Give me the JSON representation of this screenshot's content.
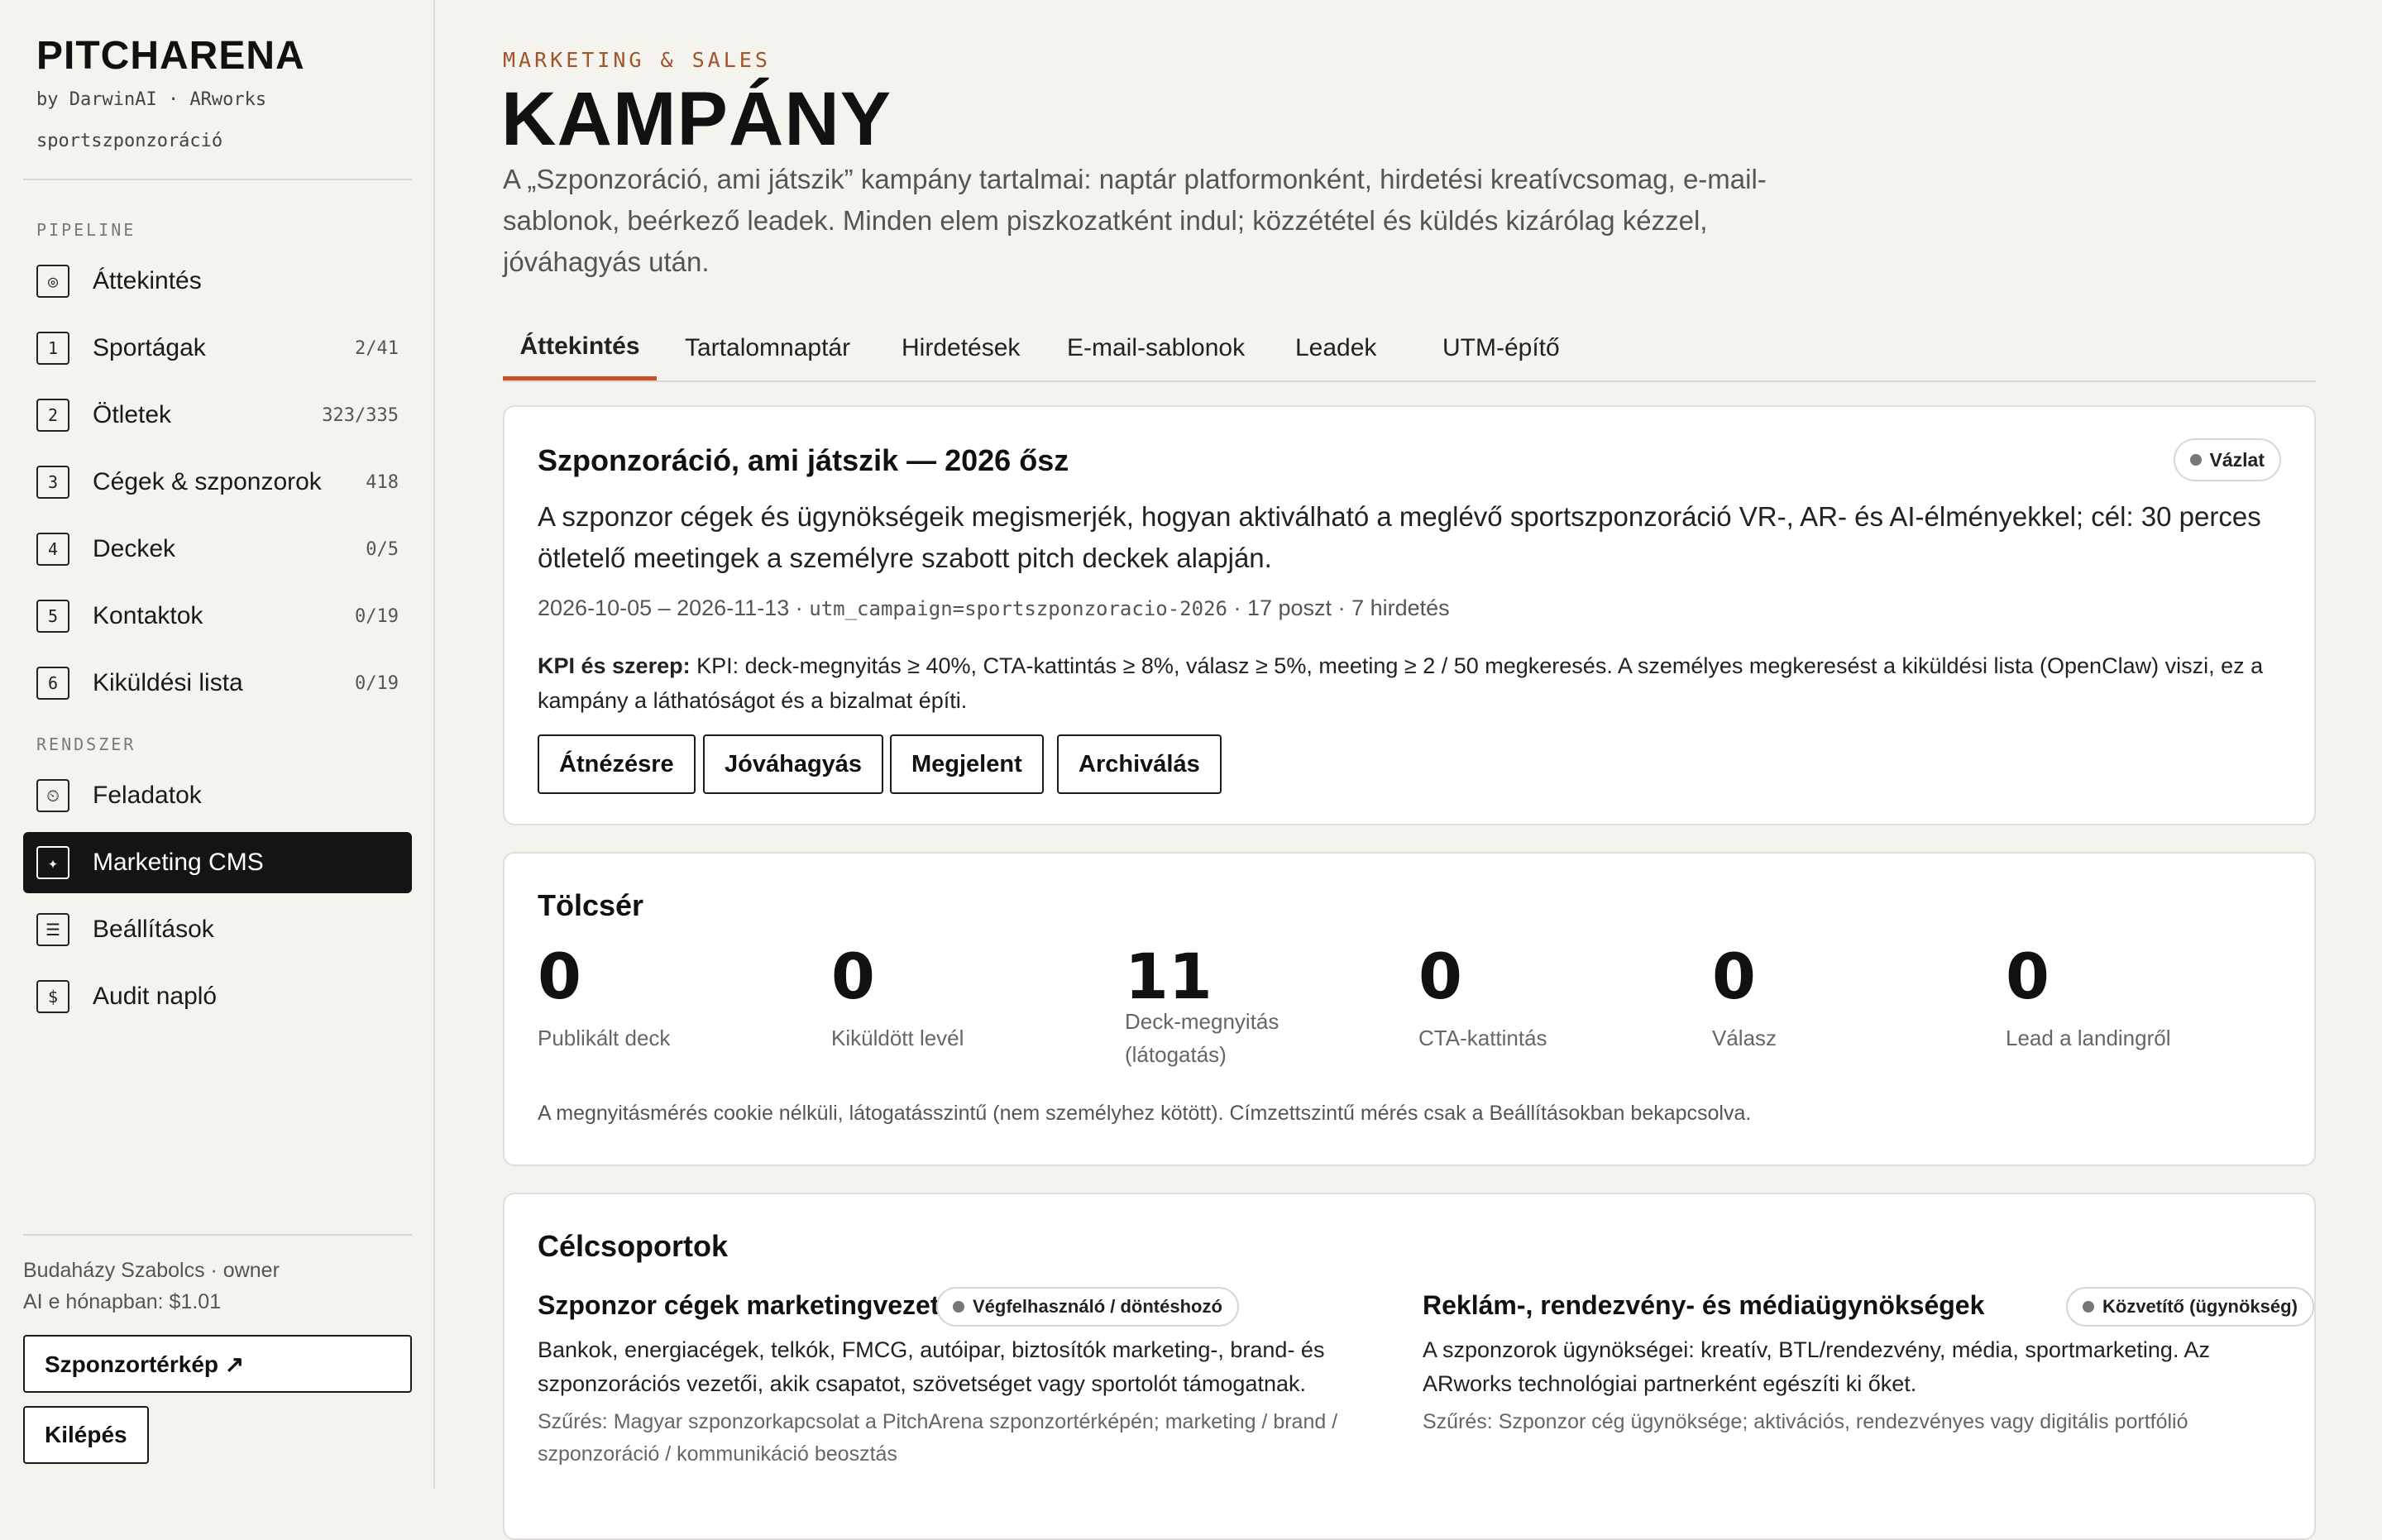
{
  "sidebar": {
    "brand": "PITCHARENA",
    "byline": "by DarwinAI · ARworks",
    "workspace": "sportszponzoráció",
    "pipeline_title": "PIPELINE",
    "system_title": "RENDSZER",
    "pipeline": [
      {
        "icon": "◎",
        "label": "Áttekintés",
        "count": ""
      },
      {
        "icon": "1",
        "label": "Sportágak",
        "count": "2/41"
      },
      {
        "icon": "2",
        "label": "Ötletek",
        "count": "323/335"
      },
      {
        "icon": "3",
        "label": "Cégek & szponzorok",
        "count": "418"
      },
      {
        "icon": "4",
        "label": "Deckek",
        "count": "0/5"
      },
      {
        "icon": "5",
        "label": "Kontaktok",
        "count": "0/19"
      },
      {
        "icon": "6",
        "label": "Kiküldési lista",
        "count": "0/19"
      }
    ],
    "system": [
      {
        "icon": "⏲",
        "label": "Feladatok"
      },
      {
        "icon": "✦",
        "label": "Marketing CMS"
      },
      {
        "icon": "☰",
        "label": "Beállítások"
      },
      {
        "icon": "$",
        "label": "Audit napló"
      }
    ],
    "user": "Budaházy Szabolcs · owner",
    "ai_usage": "AI e hónapban: $1.01",
    "map_button": "Szponzortérkép ↗",
    "logout_button": "Kilépés"
  },
  "header": {
    "eyebrow": "MARKETING & SALES",
    "title": "KAMPÁNY",
    "description": "A „Szponzoráció, ami játszik” kampány tartalmai: naptár platformonként, hirdetési kreatívcsomag, e-mail-sablonok, beérkező leadek. Minden elem piszkozatként indul; közzététel és küldés kizárólag kézzel, jóváhagyás után."
  },
  "tabs": [
    "Áttekintés",
    "Tartalomnaptár",
    "Hirdetések",
    "E-mail-sablonok",
    "Leadek",
    "UTM-építő"
  ],
  "campaign": {
    "title": "Szponzoráció, ami játszik — 2026 ősz",
    "status": "Vázlat",
    "description": "A szponzor cégek és ügynökségeik megismerjék, hogyan aktiválható a meglévő sportszponzoráció VR-, AR- és AI-élményekkel; cél: 30 perces ötletelő meetingek a személyre szabott pitch deckek alapján.",
    "dates": "2026-10-05 – 2026-11-13",
    "utm": "utm_campaign=sportszponzoracio-2026",
    "posts": "17 poszt",
    "ads": "7 hirdetés",
    "sep": " · ",
    "kpi_label": "KPI és szerep:",
    "kpi_text": " KPI: deck-megnyitás ≥ 40%, CTA-kattintás ≥ 8%, válasz ≥ 5%, meeting ≥ 2 / 50 megkeresés. A személyes megkeresést a kiküldési lista (OpenClaw) viszi, ez a kampány a láthatóságot és a bizalmat építi.",
    "actions": [
      "Átnézésre",
      "Jóváhagyás",
      "Megjelent",
      "Archiválás"
    ]
  },
  "funnel": {
    "title": "Tölcsér",
    "metrics": [
      {
        "value": "0",
        "label": "Publikált deck"
      },
      {
        "value": "0",
        "label": "Kiküldött levél"
      },
      {
        "value": "11",
        "label": "Deck-megnyitás (látogatás)"
      },
      {
        "value": "0",
        "label": "CTA-kattintás"
      },
      {
        "value": "0",
        "label": "Válasz"
      },
      {
        "value": "0",
        "label": "Lead a landingről"
      }
    ],
    "note": "A megnyitásmérés cookie nélküli, látogatásszintű (nem személyhez kötött). Címzettszintű mérés csak a Beállításokban bekapcsolva."
  },
  "segments": {
    "title": "Célcsoportok",
    "items": [
      {
        "name": "Szponzor cégek marketingvezetői",
        "tag": "Végfelhasználó / döntéshozó",
        "description": "Bankok, energiacégek, telkók, FMCG, autóipar, biztosítók marketing-, brand- és szponzorációs vezetői, akik csapatot, szövetséget vagy sportolót támogatnak.",
        "filter": "Szűrés: Magyar szponzorkapcsolat a PitchArena szponzortérképén; marketing / brand / szponzoráció / kommunikáció beosztás"
      },
      {
        "name": "Reklám-, rendezvény- és médiaügynökségek",
        "tag": "Közvetítő (ügynökség)",
        "description": "A szponzorok ügynökségei: kreatív, BTL/rendezvény, média, sportmarketing. Az ARworks technológiai partnerként egészíti ki őket.",
        "filter": "Szűrés: Szponzor cég ügynöksége; aktivációs, rendezvényes vagy digitális portfólió"
      }
    ]
  },
  "colors": {
    "accent": "#c94f27",
    "eyebrow": "#a4522a",
    "active_nav": "#141414",
    "background": "#f4f3ee"
  }
}
